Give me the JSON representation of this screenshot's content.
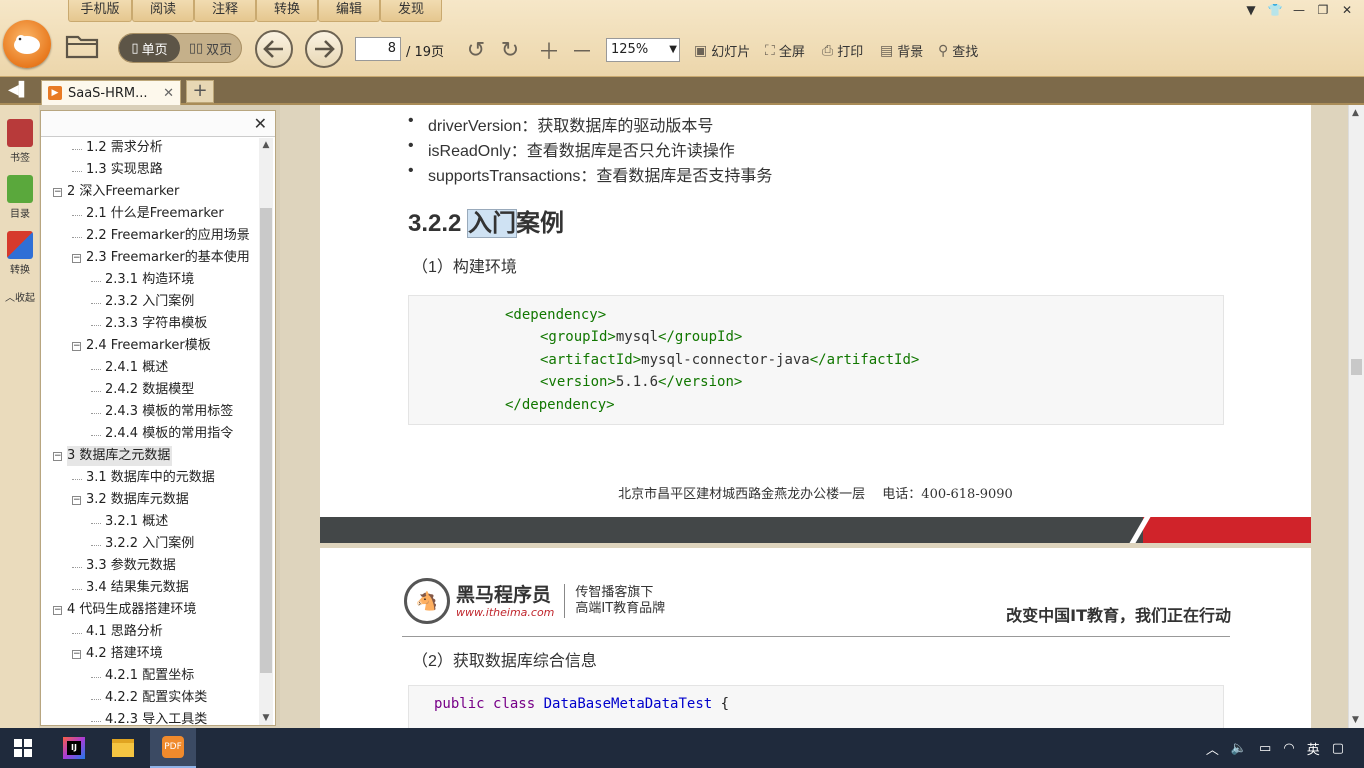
{
  "menu_tabs": [
    "手机版",
    "阅读",
    "注释",
    "转换",
    "编辑",
    "发现"
  ],
  "toolbar": {
    "single_page": "单页",
    "double_page": "双页",
    "current_page": "8",
    "total_pages": "/ 19页",
    "zoom": "125%",
    "slideshow": "幻灯片",
    "fullscreen": "全屏",
    "print": "打印",
    "background": "背景",
    "find": "查找"
  },
  "tab": {
    "title": "SaaS-HRM..."
  },
  "rail": {
    "bookmark": "书签",
    "toc": "目录",
    "convert": "转换",
    "collapse": "收起"
  },
  "outline": [
    {
      "label": "1.2 需求分析",
      "level": 1
    },
    {
      "label": "1.3 实现思路",
      "level": 1
    },
    {
      "label": "2 深入Freemarker",
      "level": 0
    },
    {
      "label": "2.1 什么是Freemarker",
      "level": 1
    },
    {
      "label": "2.2 Freemarker的应用场景",
      "level": 1
    },
    {
      "label": "2.3 Freemarker的基本使用",
      "level": 1
    },
    {
      "label": "2.3.1 构造环境",
      "level": 2
    },
    {
      "label": "2.3.2 入门案例",
      "level": 2
    },
    {
      "label": "2.3.3 字符串模板",
      "level": 2
    },
    {
      "label": "2.4 Freemarker模板",
      "level": 1
    },
    {
      "label": "2.4.1 概述",
      "level": 2
    },
    {
      "label": "2.4.2 数据模型",
      "level": 2
    },
    {
      "label": "2.4.3 模板的常用标签",
      "level": 2
    },
    {
      "label": "2.4.4 模板的常用指令",
      "level": 2
    },
    {
      "label": "3 数据库之元数据",
      "level": 0
    },
    {
      "label": "3.1 数据库中的元数据",
      "level": 1
    },
    {
      "label": "3.2 数据库元数据",
      "level": 1
    },
    {
      "label": "3.2.1 概述",
      "level": 2
    },
    {
      "label": "3.2.2 入门案例",
      "level": 2
    },
    {
      "label": "3.3 参数元数据",
      "level": 1
    },
    {
      "label": "3.4 结果集元数据",
      "level": 1
    },
    {
      "label": "4 代码生成器搭建环境",
      "level": 0
    },
    {
      "label": "4.1 思路分析",
      "level": 1
    },
    {
      "label": "4.2 搭建环境",
      "level": 1
    },
    {
      "label": "4.2.1 配置坐标",
      "level": 2
    },
    {
      "label": "4.2.2 配置实体类",
      "level": 2
    },
    {
      "label": "4.2.3 导入工具类",
      "level": 2
    }
  ],
  "doc": {
    "bullets": [
      {
        "term": "driverVersion",
        "desc": "：获取数据库的驱动版本号"
      },
      {
        "term": "isReadOnly",
        "desc": "：查看数据库是否只允许读操作"
      },
      {
        "term": "supportsTransactions",
        "desc": "：查看数据库是否支持事务"
      }
    ],
    "heading_num": "3.2.2 ",
    "heading_hl": "入门",
    "heading_rest": "案例",
    "step1": "（1）构建环境",
    "code1": {
      "open_dep": "<dependency>",
      "gid_open": "<groupId>",
      "gid_val": "mysql",
      "gid_close": "</groupId>",
      "aid_open": "<artifactId>",
      "aid_val": "mysql-connector-java",
      "aid_close": "</artifactId>",
      "ver_open": "<version>",
      "ver_val": "5.1.6",
      "ver_close": "</version>",
      "close_dep": "</dependency>"
    },
    "footer": "北京市昌平区建材城西路金燕龙办公楼一层　 电话：400-618-9090",
    "brand": "黑马程序员",
    "brand_url": "www.itheima.com",
    "brand_sub1": "传智播客旗下",
    "brand_sub2": "高端IT教育品牌",
    "slogan": "改变中国IT教育，我们正在行动",
    "step2": "（2）获取数据库综合信息",
    "code2": {
      "kw1": "public",
      "kw2": "class",
      "cls": "DataBaseMetaDataTest",
      "brace": " {"
    }
  },
  "tray": {
    "ime": "英"
  }
}
